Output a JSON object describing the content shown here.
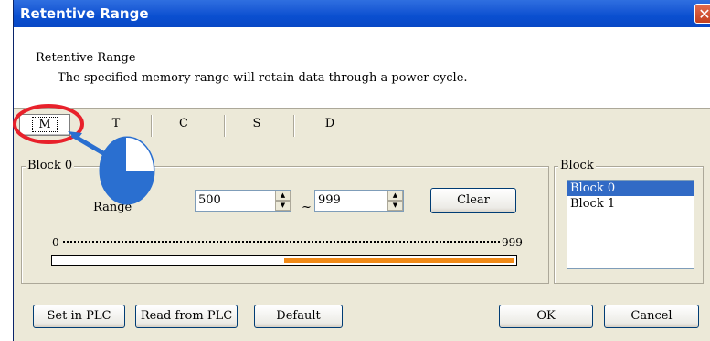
{
  "window": {
    "title": "Retentive Range",
    "close_glyph": "✕"
  },
  "header": {
    "title": "Retentive Range",
    "description": "The specified memory range will retain data through a power cycle."
  },
  "tabs": [
    {
      "label": "M",
      "active": true
    },
    {
      "label": "T",
      "active": false
    },
    {
      "label": "C",
      "active": false
    },
    {
      "label": "S",
      "active": false
    },
    {
      "label": "D",
      "active": false
    }
  ],
  "range_group": {
    "label": "Block 0",
    "range_label": "Range",
    "start": "500",
    "separator": "~",
    "end": "999",
    "clear_label": "Clear",
    "scale_min": "0",
    "scale_max": "999",
    "fill_start_fraction": 0.5,
    "fill_end_fraction": 1.0,
    "fill_color": "#f08a18"
  },
  "block_group": {
    "label": "Block",
    "items": [
      {
        "label": "Block 0",
        "selected": true
      },
      {
        "label": "Block 1",
        "selected": false
      }
    ]
  },
  "buttons": {
    "set_in_plc": "Set in PLC",
    "read_from_plc": "Read from PLC",
    "default": "Default",
    "ok": "OK",
    "cancel": "Cancel"
  },
  "annotation": {
    "highlight_color": "#e8212b",
    "callout_color": "#2a6fd0",
    "icon": "pie-chart-step-icon"
  }
}
